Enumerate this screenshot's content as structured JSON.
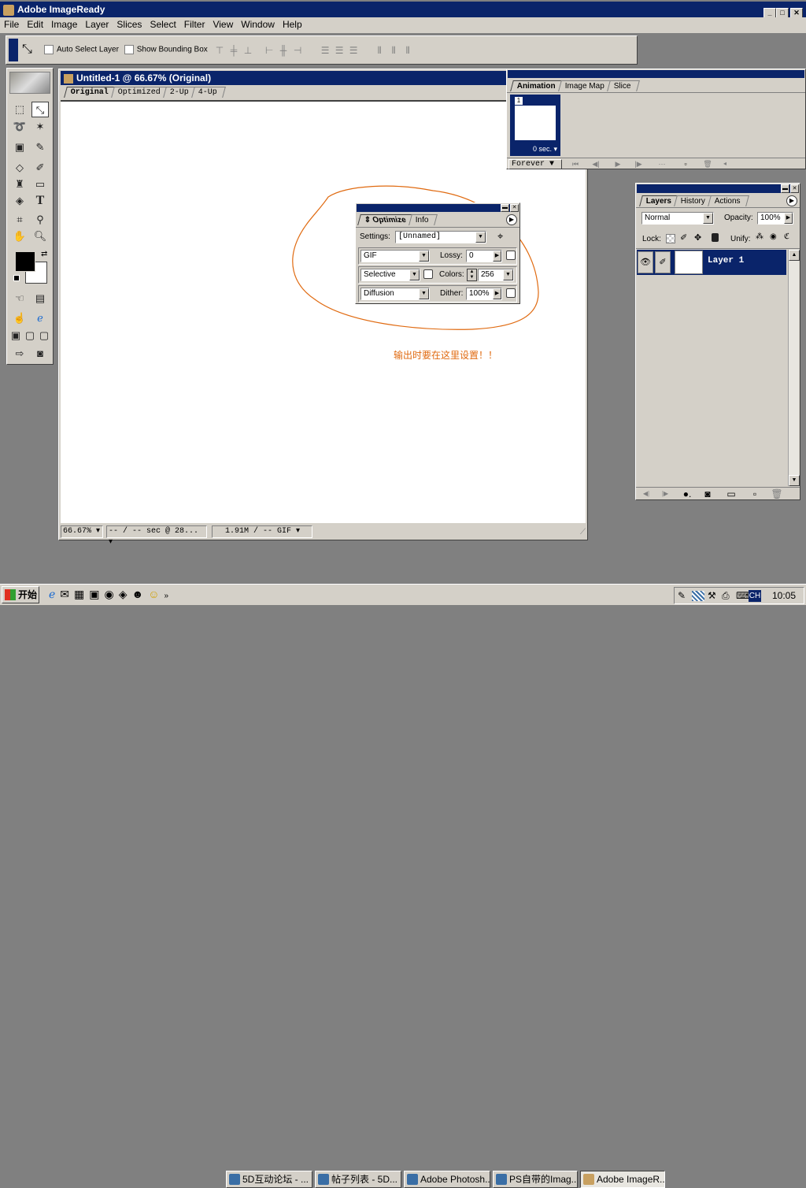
{
  "app": {
    "title": "Adobe ImageReady"
  },
  "menu": [
    "File",
    "Edit",
    "Image",
    "Layer",
    "Slices",
    "Select",
    "Filter",
    "View",
    "Window",
    "Help"
  ],
  "options_bar": {
    "auto_select": "Auto Select Layer",
    "show_bbox": "Show Bounding Box"
  },
  "document": {
    "title": "Untitled-1 @ 66.67% (Original)",
    "tabs": [
      "Original",
      "Optimized",
      "2-Up",
      "4-Up"
    ],
    "status": {
      "zoom": "66.67%",
      "time": "-- / -- sec @ 28...",
      "size": "1.91M / -- GIF"
    }
  },
  "animation": {
    "tabs": [
      "Animation",
      "Image Map",
      "Slice"
    ],
    "frame_number": "1",
    "frame_delay": "0 sec.",
    "loop": "Forever"
  },
  "optimize": {
    "tabs": [
      "Optimize",
      "Info"
    ],
    "settings_label": "Settings:",
    "settings_value": "[Unnamed]",
    "format": "GIF",
    "lossy_label": "Lossy:",
    "lossy_value": "0",
    "palette": "Selective",
    "colors_label": "Colors:",
    "colors_value": "256",
    "dither_algo": "Diffusion",
    "dither_label": "Dither:",
    "dither_value": "100%"
  },
  "annotation": "输出时要在这里设置！！",
  "layers": {
    "tabs": [
      "Layers",
      "History",
      "Actions"
    ],
    "blend_mode": "Normal",
    "opacity_label": "Opacity:",
    "opacity_value": "100%",
    "lock_label": "Lock:",
    "unify_label": "Unify:",
    "layer_name": "Layer 1"
  },
  "taskbar": {
    "start": "开始",
    "tasks": [
      "5D互动论坛 - ...",
      "帖子列表 - 5D...",
      "Adobe Photosh...",
      "PS自带的Imag...",
      "Adobe ImageR..."
    ],
    "tray_lang": "CH",
    "clock": "10:05"
  },
  "colors": {
    "titlebar": "#0a246a",
    "face": "#d4d0c8",
    "desktop": "#808080",
    "annotation": "#e06a10"
  }
}
